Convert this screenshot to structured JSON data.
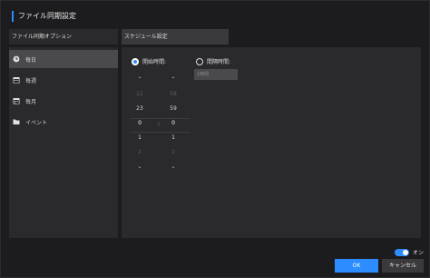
{
  "window": {
    "title": "ファイル同期設定",
    "accent": "#2d8cff"
  },
  "headers": {
    "left_label": "ファイル同期オプション",
    "right_label": "スケジュール設定"
  },
  "sidebar": {
    "items": [
      {
        "label": "毎日",
        "icon": "clock-icon",
        "active": true
      },
      {
        "label": "毎週",
        "icon": "calendar-icon",
        "active": false
      },
      {
        "label": "毎月",
        "icon": "calendar-icon",
        "active": false
      },
      {
        "label": "イベント",
        "icon": "folder-icon",
        "active": false
      }
    ]
  },
  "schedule": {
    "start_time_label": "開始時間:",
    "interval_label": "間隔時間:",
    "interval_placeholder": "1時間",
    "hour_values": [
      "22",
      "23",
      "0",
      "1",
      "2"
    ],
    "minute_values": [
      "58",
      "59",
      "0",
      "1",
      "2"
    ],
    "separator": ":",
    "selected_mode": "start_time"
  },
  "footer": {
    "toggle_label": "オン",
    "ok_label": "OK",
    "cancel_label": "キャンセル"
  }
}
